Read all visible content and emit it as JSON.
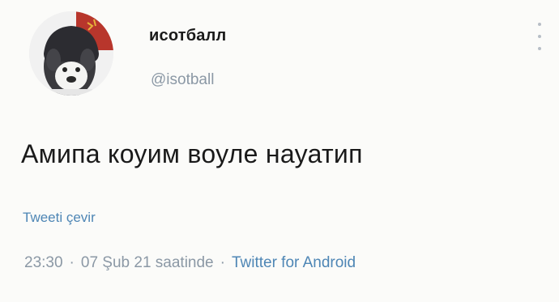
{
  "tweet": {
    "display_name": "исотбалл",
    "handle": "@isotball",
    "text": "Амипа коуим воуле науатип",
    "translate_label": "Tweeti çevir",
    "time": "23:30",
    "date_suffix": "07 Şub 21 saatinde",
    "separator": "·",
    "client": "Twitter for Android"
  },
  "icons": {
    "more": "more-vertical-icon"
  },
  "colors": {
    "link": "#4e86b5",
    "muted": "#8b98a5",
    "text": "#1a1a1a"
  }
}
